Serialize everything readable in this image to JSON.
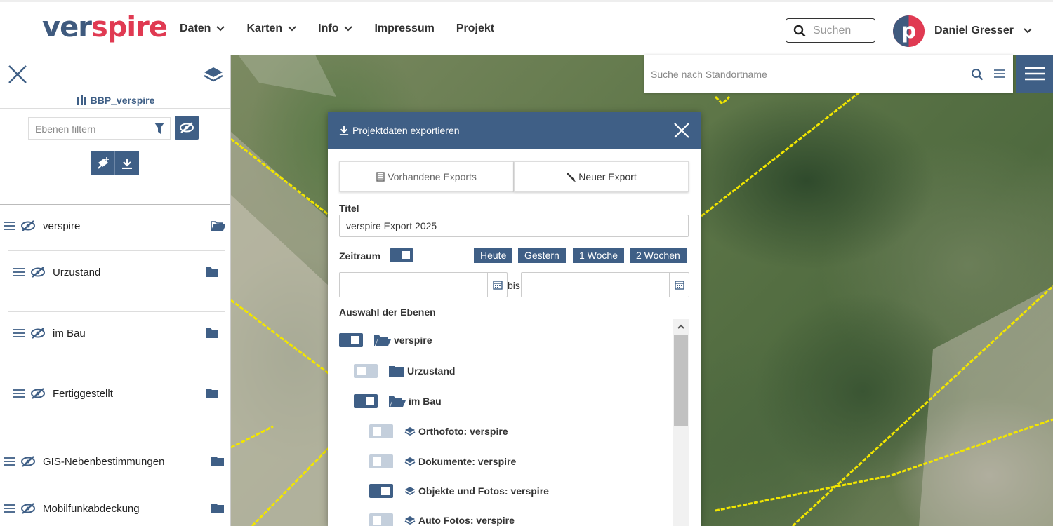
{
  "brand": {
    "logo_part1": "ver",
    "logo_part2": "spire"
  },
  "nav": {
    "items": [
      {
        "label": "Daten",
        "dropdown": true
      },
      {
        "label": "Karten",
        "dropdown": true
      },
      {
        "label": "Info",
        "dropdown": true
      },
      {
        "label": "Impressum",
        "dropdown": false
      },
      {
        "label": "Projekt",
        "dropdown": false
      }
    ],
    "search_placeholder": "Suchen",
    "avatar_letter": "p",
    "user_name": "Daniel Gresser"
  },
  "map": {
    "search_placeholder": "Suche nach Standortname"
  },
  "sidebar": {
    "project_name": "BBP_verspire",
    "filter_placeholder": "Ebenen filtern",
    "layers": [
      {
        "label": "verspire",
        "folder": "open"
      },
      {
        "label": "Urzustand",
        "folder": "closed"
      },
      {
        "label": "im Bau",
        "folder": "closed"
      },
      {
        "label": "Fertiggestellt",
        "folder": "closed"
      },
      {
        "label": "GIS-Nebenbestimmungen",
        "folder": "closed"
      },
      {
        "label": "Mobilfunkabdeckung",
        "folder": "closed"
      }
    ]
  },
  "dialog": {
    "title": "Projektdaten exportieren",
    "tabs": [
      {
        "label": "Vorhandene Exports",
        "active": false
      },
      {
        "label": "Neuer Export",
        "active": true
      }
    ],
    "title_label": "Titel",
    "title_value": "verspire Export 2025",
    "zeitraum_label": "Zeitraum",
    "zeitraum_enabled": true,
    "quick_ranges": [
      "Heute",
      "Gestern",
      "1 Woche",
      "2 Wochen"
    ],
    "date_separator": "bis",
    "date_from": "",
    "date_to": "",
    "layers_label": "Auswahl der Ebenen",
    "tree": [
      {
        "label": "verspire",
        "checked": true,
        "kind": "folder-open"
      },
      {
        "label": "Urzustand",
        "checked": false,
        "kind": "folder"
      },
      {
        "label": "im Bau",
        "checked": true,
        "kind": "folder-open"
      },
      {
        "label": "Orthofoto: verspire",
        "checked": false,
        "kind": "layer"
      },
      {
        "label": "Dokumente: verspire",
        "checked": false,
        "kind": "layer"
      },
      {
        "label": "Objekte und Fotos: verspire",
        "checked": true,
        "kind": "layer"
      },
      {
        "label": "Auto Fotos: verspire",
        "checked": false,
        "kind": "layer"
      }
    ]
  },
  "colors": {
    "primary": "#3f5f86",
    "accent": "#e03a52",
    "parcel_line": "#f2e600"
  }
}
